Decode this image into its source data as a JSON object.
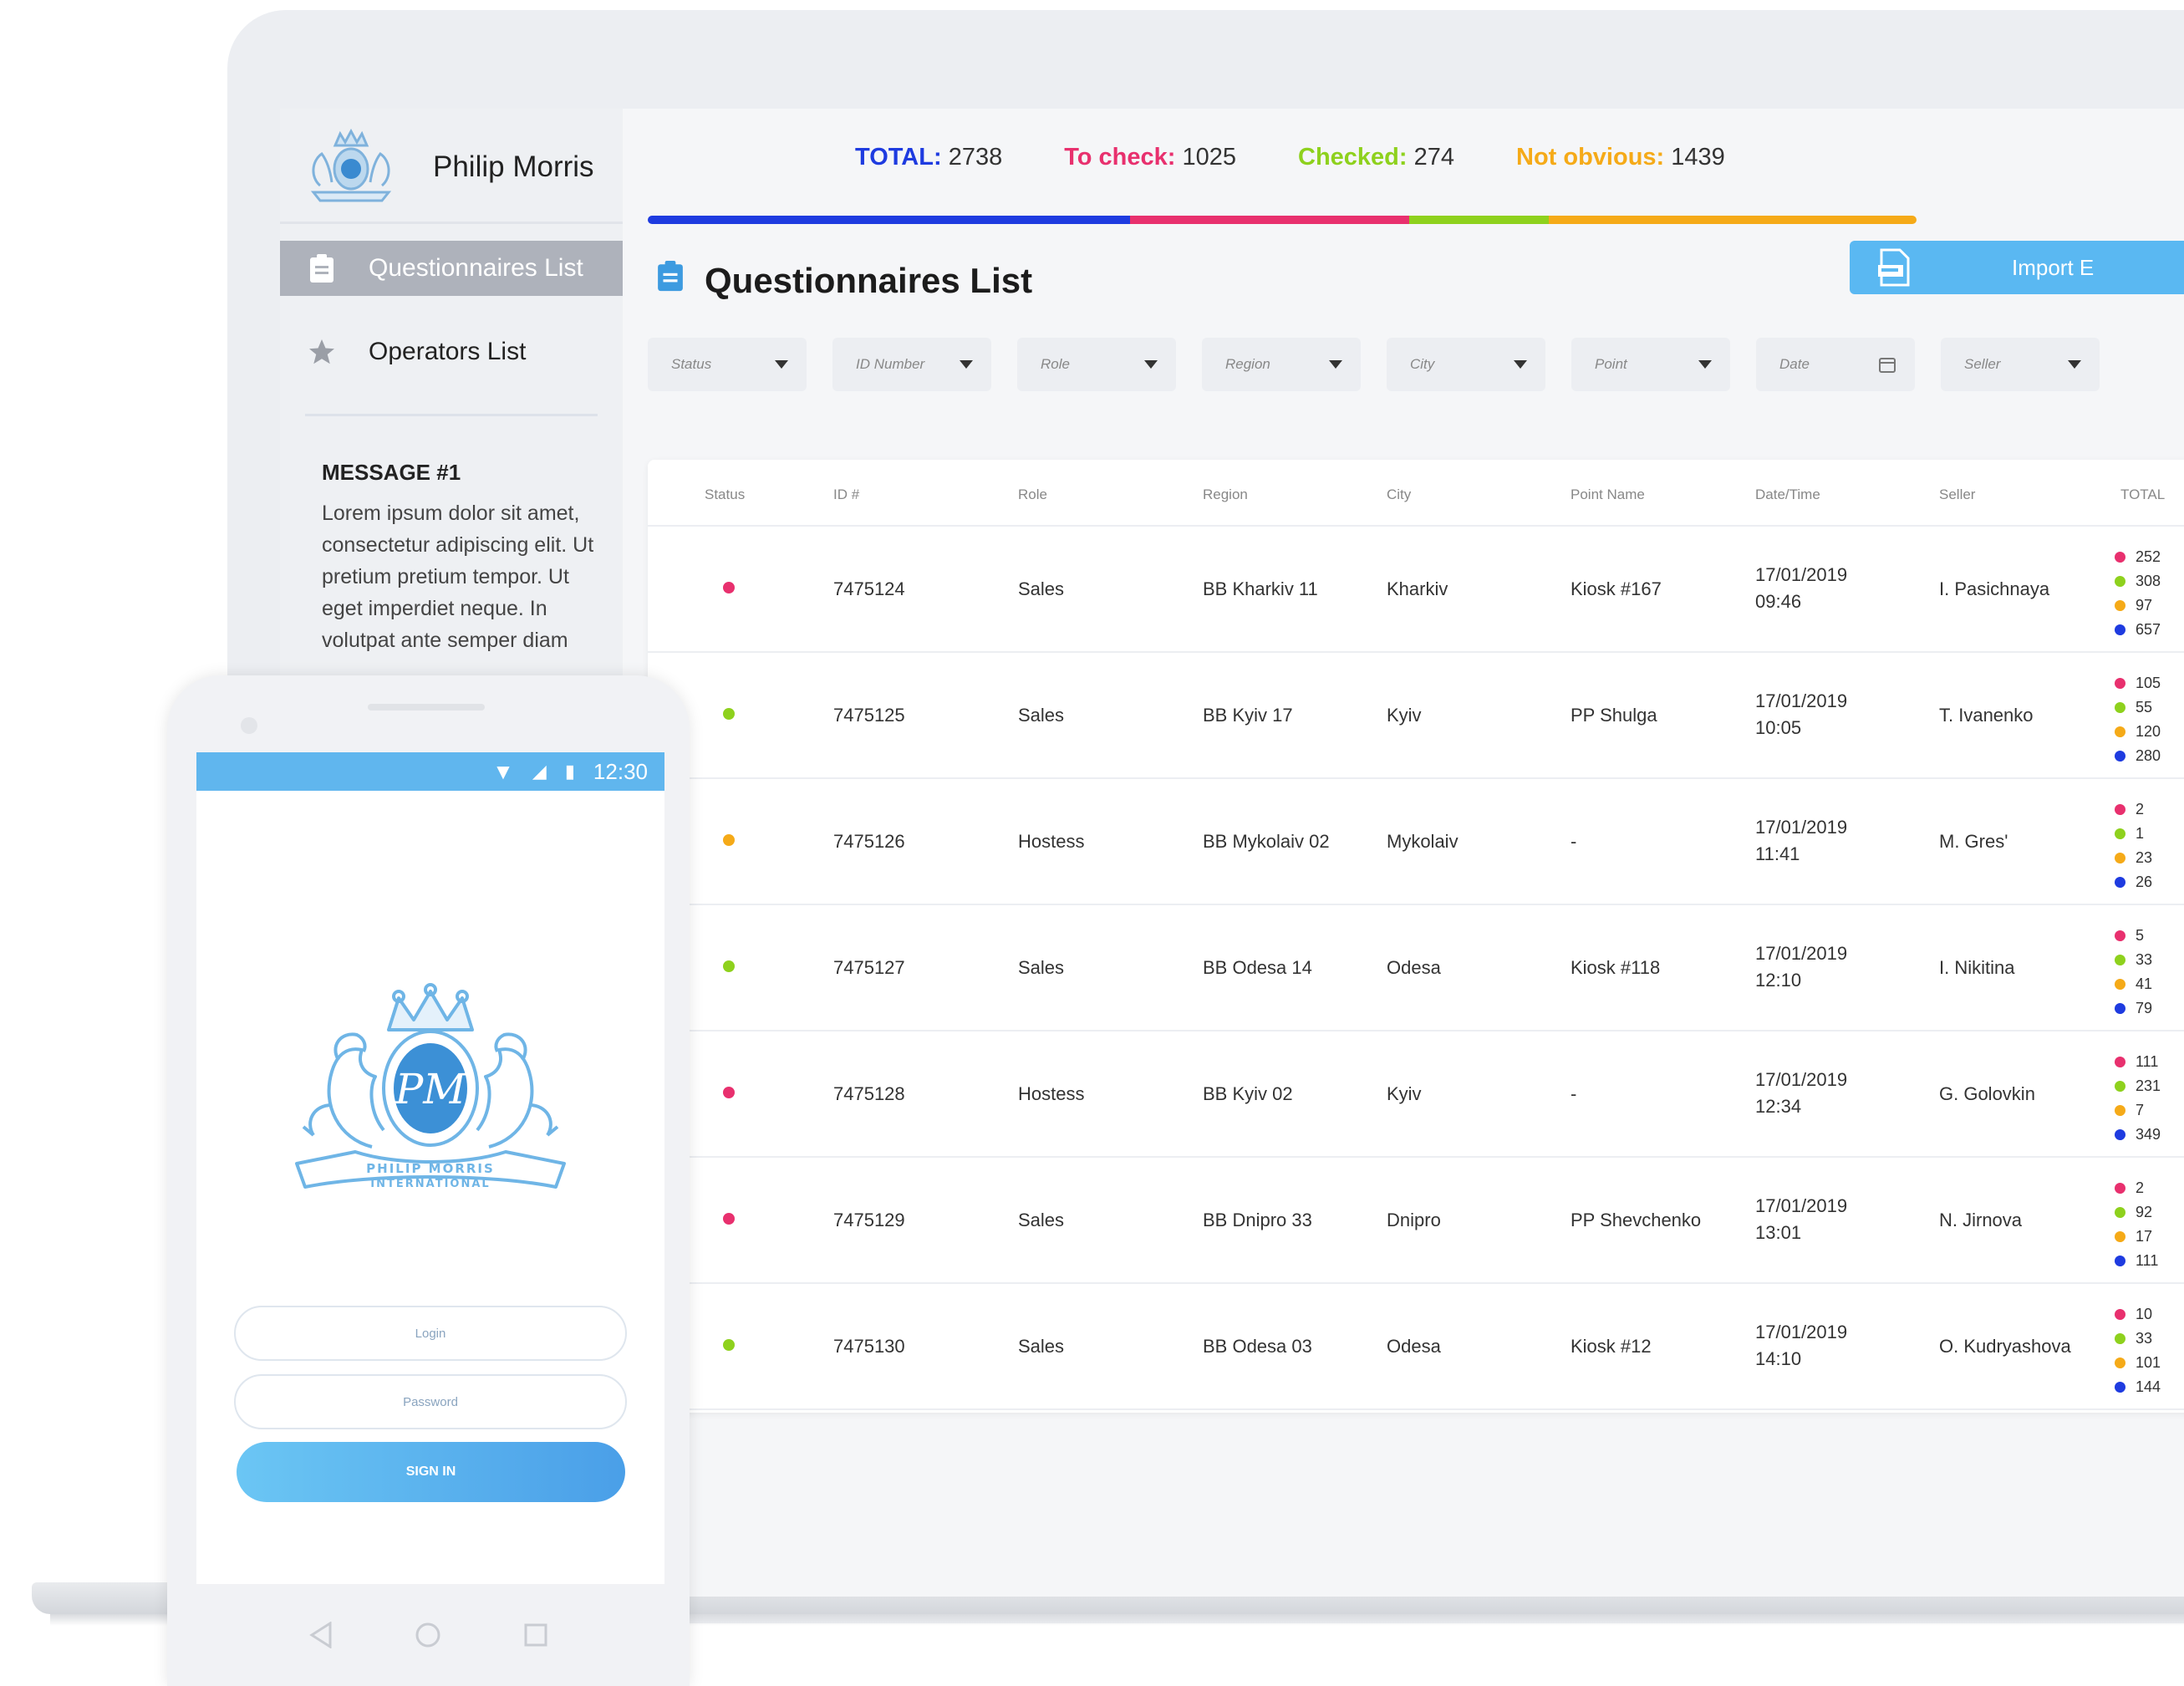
{
  "brand": {
    "name": "Philip Morris"
  },
  "stats": {
    "total": {
      "label": "TOTAL:",
      "value": "2738",
      "color": "#1e3be0"
    },
    "to_check": {
      "label": "To check:",
      "value": "1025",
      "color": "#e8306e"
    },
    "checked": {
      "label": "Checked:",
      "value": "274",
      "color": "#8ed11d"
    },
    "not_obvious": {
      "label": "Not obvious:",
      "value": "1439",
      "color": "#f5aa18"
    }
  },
  "sidebar": {
    "items": [
      {
        "label": "Questionnaires List",
        "icon": "clipboard-icon",
        "active": true
      },
      {
        "label": "Operators List",
        "icon": "star-icon",
        "active": false
      }
    ],
    "message": {
      "title": "MESSAGE #1",
      "body": "Lorem ipsum dolor sit amet, consectetur adipiscing elit. Ut pretium pretium tempor. Ut eget imperdiet neque. In volutpat ante semper diam"
    }
  },
  "page": {
    "title": "Questionnaires List",
    "import_label": "Import E"
  },
  "filters": [
    {
      "label": "Status",
      "icon": "caret-down"
    },
    {
      "label": "ID Number",
      "icon": "caret-down"
    },
    {
      "label": "Role",
      "icon": "caret-down"
    },
    {
      "label": "Region",
      "icon": "caret-down"
    },
    {
      "label": "City",
      "icon": "caret-down"
    },
    {
      "label": "Point",
      "icon": "caret-down"
    },
    {
      "label": "Date",
      "icon": "calendar"
    },
    {
      "label": "Seller",
      "icon": "caret-down"
    }
  ],
  "table": {
    "headers": [
      "Status",
      "ID #",
      "Role",
      "Region",
      "City",
      "Point Name",
      "Date/Time",
      "Seller",
      "TOTAL"
    ],
    "rows": [
      {
        "status": "to-check",
        "id": "7475124",
        "role": "Sales",
        "region": "BB Kharkiv 11",
        "city": "Kharkiv",
        "point": "Kiosk #167",
        "date": "17/01/2019",
        "time": "09:46",
        "seller": "I. Pasichnaya",
        "totals": [
          "252",
          "308",
          "97",
          "657"
        ]
      },
      {
        "status": "checked",
        "id": "7475125",
        "role": "Sales",
        "region": "BB Kyiv 17",
        "city": "Kyiv",
        "point": "PP Shulga",
        "date": "17/01/2019",
        "time": "10:05",
        "seller": "T. Ivanenko",
        "totals": [
          "105",
          "55",
          "120",
          "280"
        ]
      },
      {
        "status": "not-obvious",
        "id": "7475126",
        "role": "Hostess",
        "region": "BB Mykolaiv 02",
        "city": "Mykolaiv",
        "point": "-",
        "date": "17/01/2019",
        "time": "11:41",
        "seller": "M. Gres'",
        "totals": [
          "2",
          "1",
          "23",
          "26"
        ]
      },
      {
        "status": "checked",
        "id": "7475127",
        "role": "Sales",
        "region": "BB Odesa 14",
        "city": "Odesa",
        "point": "Kiosk #118",
        "date": "17/01/2019",
        "time": "12:10",
        "seller": "I. Nikitina",
        "totals": [
          "5",
          "33",
          "41",
          "79"
        ]
      },
      {
        "status": "to-check",
        "id": "7475128",
        "role": "Hostess",
        "region": "BB Kyiv 02",
        "city": "Kyiv",
        "point": "-",
        "date": "17/01/2019",
        "time": "12:34",
        "seller": "G. Golovkin",
        "totals": [
          "111",
          "231",
          "7",
          "349"
        ]
      },
      {
        "status": "to-check",
        "id": "7475129",
        "role": "Sales",
        "region": "BB Dnipro 33",
        "city": "Dnipro",
        "point": "PP Shevchenko",
        "date": "17/01/2019",
        "time": "13:01",
        "seller": "N. Jirnova",
        "totals": [
          "2",
          "92",
          "17",
          "111"
        ]
      },
      {
        "status": "checked",
        "id": "7475130",
        "role": "Sales",
        "region": "BB Odesa 03",
        "city": "Odesa",
        "point": "Kiosk #12",
        "date": "17/01/2019",
        "time": "14:10",
        "seller": "O. Kudryashova",
        "totals": [
          "10",
          "33",
          "101",
          "144"
        ]
      }
    ]
  },
  "colors": {
    "to-check": "#e8306e",
    "checked": "#8ed11d",
    "not-obvious": "#f5aa18",
    "total": "#1e3be0",
    "total_dot_order": [
      "#e8306e",
      "#8ed11d",
      "#f5aa18",
      "#1e3be0"
    ]
  },
  "phone": {
    "time": "12:30",
    "crest_text": "PHILIP MORRIS INTERNATIONAL",
    "login_placeholder": "Login",
    "password_placeholder": "Password",
    "signin_label": "SIGN IN"
  }
}
